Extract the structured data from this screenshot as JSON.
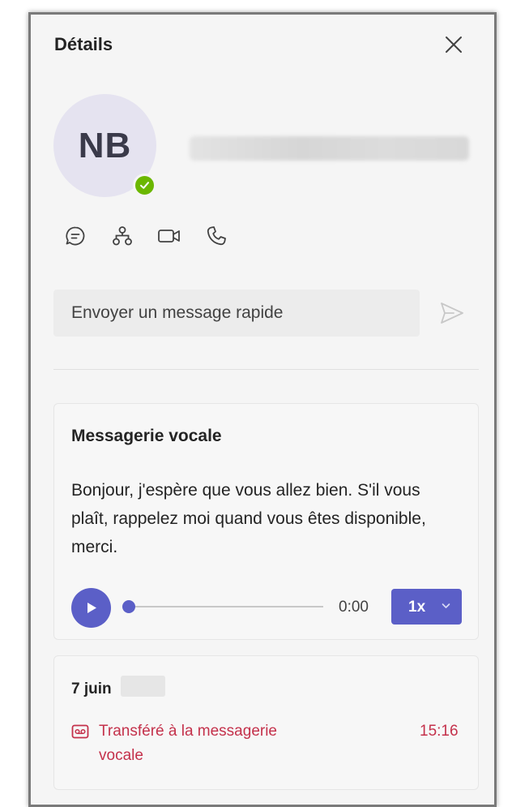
{
  "panel": {
    "title": "Détails"
  },
  "contact": {
    "initials": "NB",
    "presence": "available"
  },
  "actions": [
    {
      "icon": "chat-icon"
    },
    {
      "icon": "org-chart-icon"
    },
    {
      "icon": "video-call-icon"
    },
    {
      "icon": "phone-call-icon"
    }
  ],
  "quick_message": {
    "placeholder": "Envoyer un message rapide",
    "value": ""
  },
  "voicemail": {
    "title": "Messagerie vocale",
    "transcript": "Bonjour, j'espère que vous allez bien. S'il vous plaît, rappelez moi quand vous êtes disponible, merci.",
    "time": "0:00",
    "progress": 0,
    "speed": "1x"
  },
  "history": {
    "date": "7 juin",
    "entries": [
      {
        "icon": "voicemail-icon",
        "text": "Transféré à la messagerie vocale",
        "time": "15:16"
      }
    ]
  },
  "colors": {
    "accent": "#5b5fc7",
    "presence_available": "#6bb700",
    "alert_text": "#c4314b",
    "panel_bg": "#f5f5f5"
  }
}
